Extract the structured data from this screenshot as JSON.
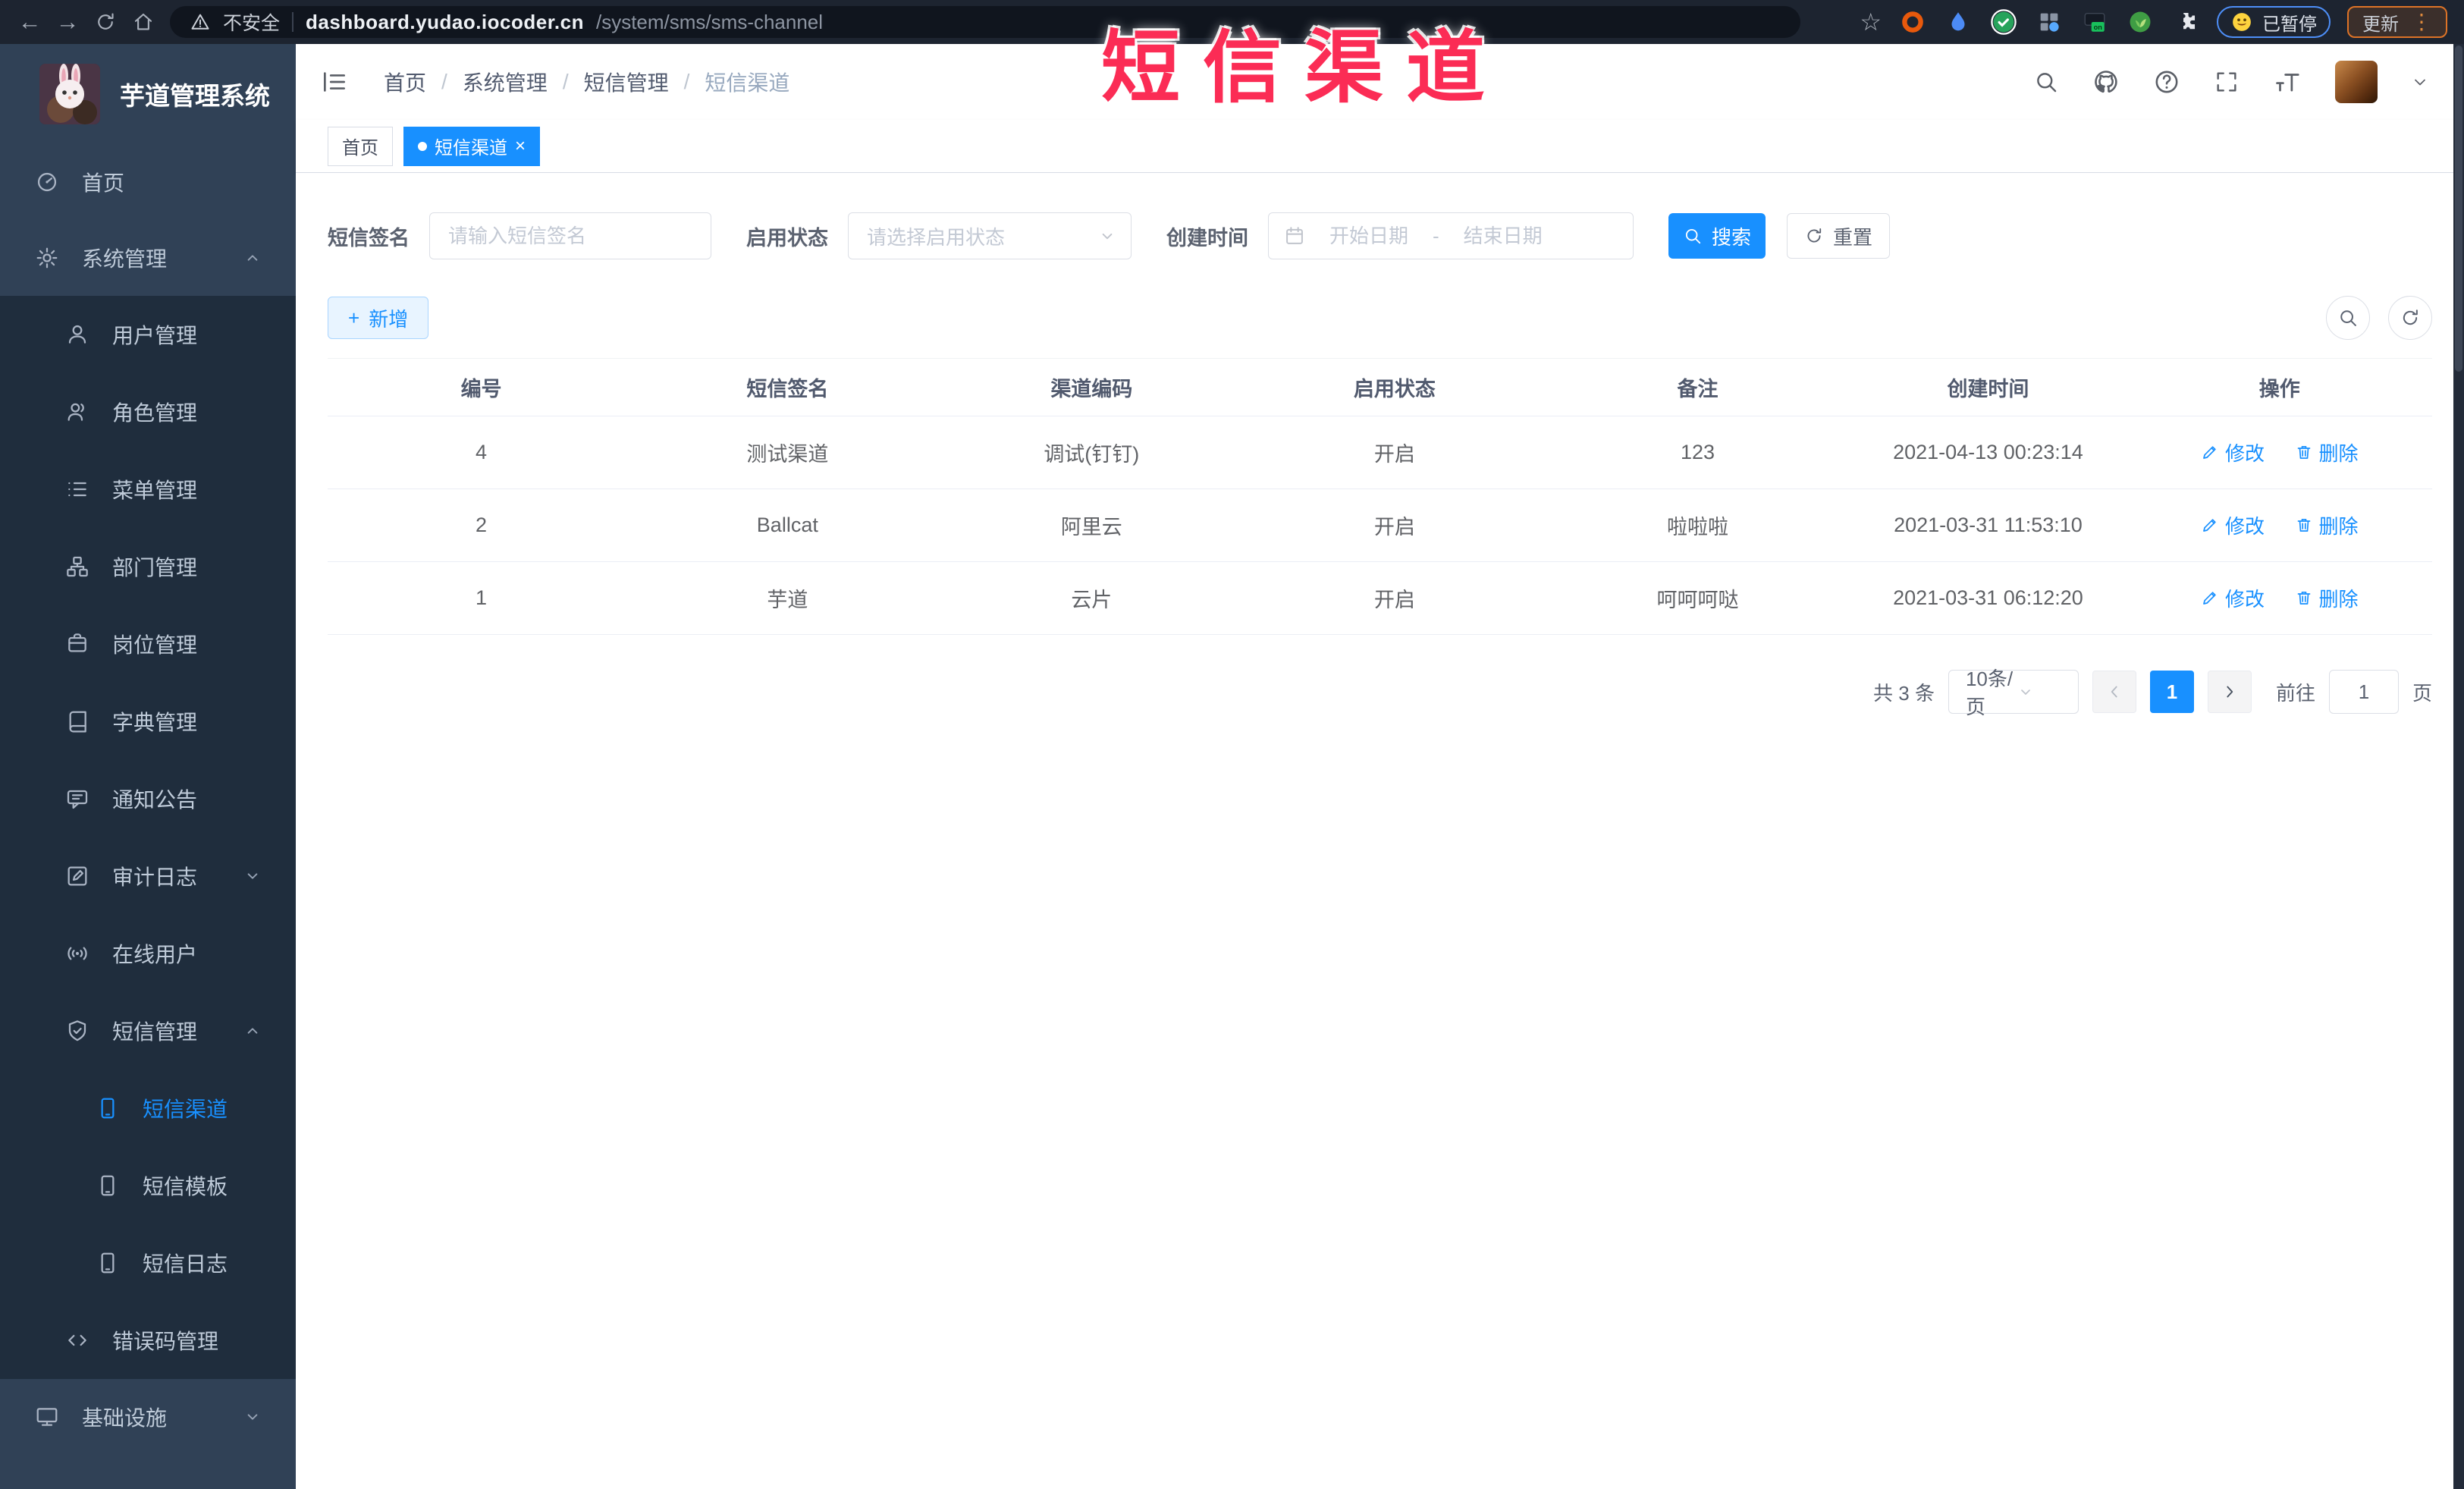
{
  "overlay_title": "短信渠道",
  "browser": {
    "warning_label": "不安全",
    "url_host": "dashboard.yudao.iocoder.cn",
    "url_path": "/system/sms/sms-channel",
    "paused_label": "已暂停",
    "update_label": "更新"
  },
  "sidebar": {
    "logo_title": "芋道管理系统",
    "items": [
      {
        "label": "首页"
      },
      {
        "label": "系统管理"
      },
      {
        "label": "用户管理"
      },
      {
        "label": "角色管理"
      },
      {
        "label": "菜单管理"
      },
      {
        "label": "部门管理"
      },
      {
        "label": "岗位管理"
      },
      {
        "label": "字典管理"
      },
      {
        "label": "通知公告"
      },
      {
        "label": "审计日志"
      },
      {
        "label": "在线用户"
      },
      {
        "label": "短信管理"
      },
      {
        "label": "短信渠道"
      },
      {
        "label": "短信模板"
      },
      {
        "label": "短信日志"
      },
      {
        "label": "错误码管理"
      },
      {
        "label": "基础设施"
      }
    ]
  },
  "header": {
    "breadcrumb": [
      "首页",
      "系统管理",
      "短信管理",
      "短信渠道"
    ]
  },
  "tags": {
    "home": "首页",
    "active": "短信渠道"
  },
  "filters": {
    "sign_label": "短信签名",
    "sign_placeholder": "请输入短信签名",
    "status_label": "启用状态",
    "status_placeholder": "请选择启用状态",
    "time_label": "创建时间",
    "start_placeholder": "开始日期",
    "range_separator": "-",
    "end_placeholder": "结束日期",
    "search_label": "搜索",
    "reset_label": "重置"
  },
  "toolbar": {
    "add_label": "新增"
  },
  "table": {
    "headers": [
      "编号",
      "短信签名",
      "渠道编码",
      "启用状态",
      "备注",
      "创建时间",
      "操作"
    ],
    "rows": [
      {
        "cells": [
          "4",
          "测试渠道",
          "调试(钉钉)",
          "开启",
          "123",
          "2021-04-13 00:23:14"
        ]
      },
      {
        "cells": [
          "2",
          "Ballcat",
          "阿里云",
          "开启",
          "啦啦啦",
          "2021-03-31 11:53:10"
        ]
      },
      {
        "cells": [
          "1",
          "芋道",
          "云片",
          "开启",
          "呵呵呵哒",
          "2021-03-31 06:12:20"
        ]
      }
    ],
    "edit_label": "修改",
    "delete_label": "删除"
  },
  "pagination": {
    "total": "共 3 条",
    "page_size": "10条/页",
    "current_page": "1",
    "goto_label": "前往",
    "goto_value": "1",
    "page_unit": "页"
  },
  "colors": {
    "accent": "#1890ff",
    "overlay_title": "#fb2c55",
    "sidebar_bg": "#304156",
    "submenu_bg": "#1f2d3d"
  }
}
